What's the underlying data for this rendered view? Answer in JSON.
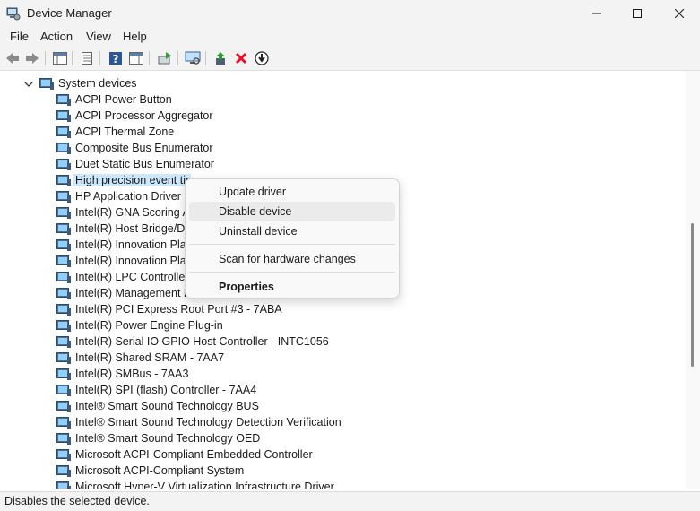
{
  "window": {
    "title": "Device Manager",
    "controls": [
      "minimize",
      "maximize",
      "close"
    ]
  },
  "menu": [
    "File",
    "Action",
    "View",
    "Help"
  ],
  "toolbar": [
    "back-icon",
    "forward-icon",
    "show-hide-console-tree-icon",
    "properties-icon",
    "help-icon",
    "action-pane-icon",
    "update-driver-icon",
    "scan-hardware-icon",
    "enable-device-icon",
    "uninstall-device-icon",
    "disable-device-icon"
  ],
  "tree": {
    "category": "System devices",
    "devices": [
      "ACPI Power Button",
      "ACPI Processor Aggregator",
      "ACPI Thermal Zone",
      "Composite Bus Enumerator",
      "Duet Static Bus Enumerator",
      "High precision event tir",
      "HP Application Driver",
      "Intel(R) GNA Scoring A",
      "Intel(R) Host Bridge/DR",
      "Intel(R) Innovation Plat",
      "Intel(R) Innovation Plat",
      "Intel(R) LPC Controller/",
      "Intel(R) Management E",
      "Intel(R) PCI Express Root Port #3 - 7ABA",
      "Intel(R) Power Engine Plug-in",
      "Intel(R) Serial IO GPIO Host Controller - INTC1056",
      "Intel(R) Shared SRAM - 7AA7",
      "Intel(R) SMBus - 7AA3",
      "Intel(R) SPI (flash) Controller - 7AA4",
      "Intel® Smart Sound Technology BUS",
      "Intel® Smart Sound Technology Detection Verification",
      "Intel® Smart Sound Technology OED",
      "Microsoft ACPI-Compliant Embedded Controller",
      "Microsoft ACPI-Compliant System",
      "Microsoft Hyper-V Virtualization Infrastructure Driver"
    ],
    "selected_device": "High precision event tir"
  },
  "context_menu": {
    "items": [
      "Update driver",
      "Disable device",
      "Uninstall device",
      "Scan for hardware changes",
      "Properties"
    ],
    "hovered": "Disable device",
    "default": "Properties"
  },
  "status": "Disables the selected device.",
  "colors": {
    "selection": "#cce8ff",
    "hover": "#ebebeb",
    "disable_red": "#e81123",
    "help_blue": "#2b5797"
  }
}
